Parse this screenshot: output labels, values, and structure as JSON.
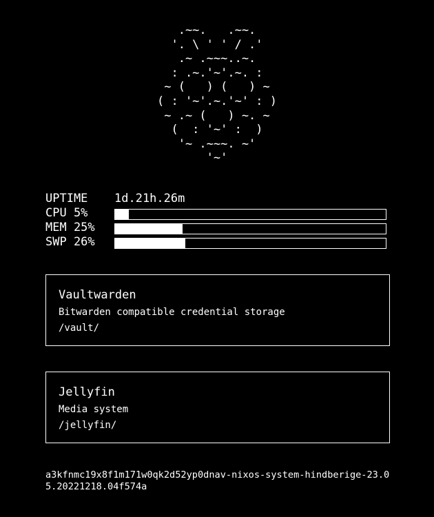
{
  "logo": {
    "lines": [
      " .~~.   .~~. ",
      "'. \\ ' ' / .'",
      " .~ .~~~..~. ",
      ": .~.'~'.~. :",
      "~ (   ) (   ) ~",
      "( : '~'.~.'~' : )",
      "~ .~ (   ) ~. ~",
      " (  : '~' :  ) ",
      "'~ .~~~. ~'",
      "'~'"
    ]
  },
  "stats": {
    "uptime": {
      "label": "UPTIME",
      "value": "1d.21h.26m"
    },
    "cpu": {
      "label": "CPU 5%",
      "percent": 5
    },
    "mem": {
      "label": "MEM 25%",
      "percent": 25
    },
    "swp": {
      "label": "SWP 26%",
      "percent": 26
    }
  },
  "services": [
    {
      "title": "Vaultwarden",
      "description": "Bitwarden compatible credential storage",
      "path": "/vault/"
    },
    {
      "title": "Jellyfin",
      "description": "Media system",
      "path": "/jellyfin/"
    }
  ],
  "footer": {
    "system_path": "a3kfnmc19x8f1m171w0qk2d52yp0dnav-nixos-system-hindberige-23.05.20221218.04f574a"
  },
  "colors": {
    "background": "#000000",
    "foreground": "#ffffff"
  }
}
